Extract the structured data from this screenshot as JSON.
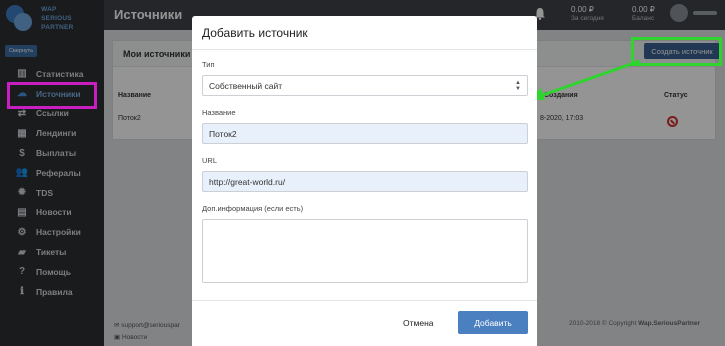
{
  "app": {
    "logo_line1": "WAP",
    "logo_line2": "SERIOUS PARTNER",
    "collapse_label": "Свернуть",
    "page_title": "Источники"
  },
  "sidebar": {
    "items": [
      {
        "label": "Статистика",
        "icon": "bar-chart-icon"
      },
      {
        "label": "Источники",
        "icon": "cloud-upload-icon",
        "active": true
      },
      {
        "label": "Ссылки",
        "icon": "link-icon"
      },
      {
        "label": "Лендинги",
        "icon": "grid-icon"
      },
      {
        "label": "Выплаты",
        "icon": "dollar-icon"
      },
      {
        "label": "Рефералы",
        "icon": "users-icon"
      },
      {
        "label": "TDS",
        "icon": "gear-icon"
      },
      {
        "label": "Новости",
        "icon": "news-icon"
      },
      {
        "label": "Настройки",
        "icon": "cog-icon"
      },
      {
        "label": "Тикеты",
        "icon": "ticket-icon"
      },
      {
        "label": "Помощь",
        "icon": "help-icon"
      },
      {
        "label": "Правила",
        "icon": "info-icon"
      }
    ]
  },
  "topbar": {
    "today_value": "0.00 ₽",
    "today_label": "За сегодня",
    "balance_value": "0.00 ₽",
    "balance_label": "Баланс"
  },
  "main": {
    "card_title": "Мои источники",
    "create_button": "Создать источник",
    "col_name": "Название",
    "col_created": "Создания",
    "col_status": "Статус",
    "row_name": "Поток2",
    "row_created": "8-2020, 17:03",
    "footer_email": "support@seriouspar",
    "footer_news": "Новости",
    "footer_copyright": "2010-2018 © Copyright",
    "footer_brand": "Wap.SeriousPartner"
  },
  "modal": {
    "title": "Добавить источник",
    "type_label": "Тип",
    "type_value": "Собственный сайт",
    "name_label": "Название",
    "name_value": "Поток2",
    "url_label": "URL",
    "url_value": "http://great-world.ru/",
    "info_label": "Доп.информация (если есть)",
    "info_value": "",
    "cancel_label": "Отмена",
    "add_label": "Добавить"
  },
  "colors": {
    "accent": "#4a7fc0",
    "highlight_sources": "#c81ec2",
    "highlight_create": "#2fd42f",
    "sidebar_bg": "#2b2f33"
  }
}
